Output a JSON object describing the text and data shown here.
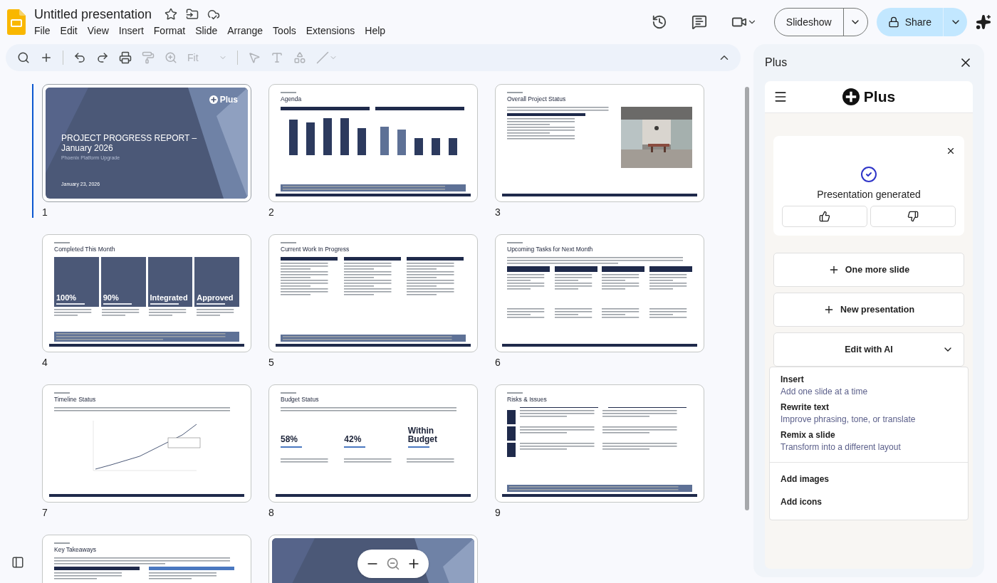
{
  "app": {
    "title": "Untitled presentation",
    "menu": [
      "File",
      "Edit",
      "View",
      "Insert",
      "Format",
      "Slide",
      "Arrange",
      "Tools",
      "Extensions",
      "Help"
    ]
  },
  "toolbar": {
    "zoom": "Fit"
  },
  "header": {
    "slideshow": "Slideshow",
    "share": "Share"
  },
  "slides": [
    {
      "kind": "title",
      "number": "1",
      "selected": true,
      "logo": "Plus",
      "title": "PROJECT PROGRESS REPORT – January 2026",
      "subtitle": "Phoenix Platform Upgrade",
      "date": "January 23, 2026"
    },
    {
      "kind": "bars",
      "number": "2",
      "selected": false,
      "title": "Agenda"
    },
    {
      "number": "3",
      "selected": false,
      "title": "Overall Project Status"
    },
    {
      "kind": "tiles",
      "number": "4",
      "selected": false,
      "title": "Completed This Month",
      "stats": [
        "100%",
        "90%",
        "Integrated",
        "Approved"
      ]
    },
    {
      "kind": "columns",
      "number": "5",
      "selected": false,
      "title": "Current Work In Progress"
    },
    {
      "kind": "grid",
      "number": "6",
      "selected": false,
      "title": "Upcoming Tasks for Next Month"
    },
    {
      "kind": "line",
      "number": "7",
      "selected": false,
      "title": "Timeline Status"
    },
    {
      "kind": "stats",
      "number": "8",
      "selected": false,
      "title": "Budget Status",
      "stats": [
        "58%",
        "42%",
        "Within Budget"
      ]
    },
    {
      "kind": "risks",
      "number": "9",
      "selected": false,
      "title": "Risks & Issues"
    },
    {
      "kind": "summary",
      "selected": false,
      "title": "Key Takeaways"
    },
    {
      "kind": "title",
      "selected": false
    }
  ],
  "panel": {
    "title": "Plus",
    "brand": "Plus",
    "notice": "Presentation generated",
    "actions": [
      "One more slide",
      "New presentation"
    ],
    "dropdown": {
      "label": "Edit with AI",
      "expanded": true
    },
    "menu_groups": [
      [
        {
          "title": "Insert",
          "description": "Add one slide at a time"
        },
        {
          "title": "Rewrite text",
          "description": "Improve phrasing, tone, or translate"
        },
        {
          "title": "Remix a slide",
          "description": "Transform into a different layout"
        }
      ],
      [
        {
          "title": "Add images"
        },
        {
          "title": "Add icons"
        }
      ]
    ]
  }
}
